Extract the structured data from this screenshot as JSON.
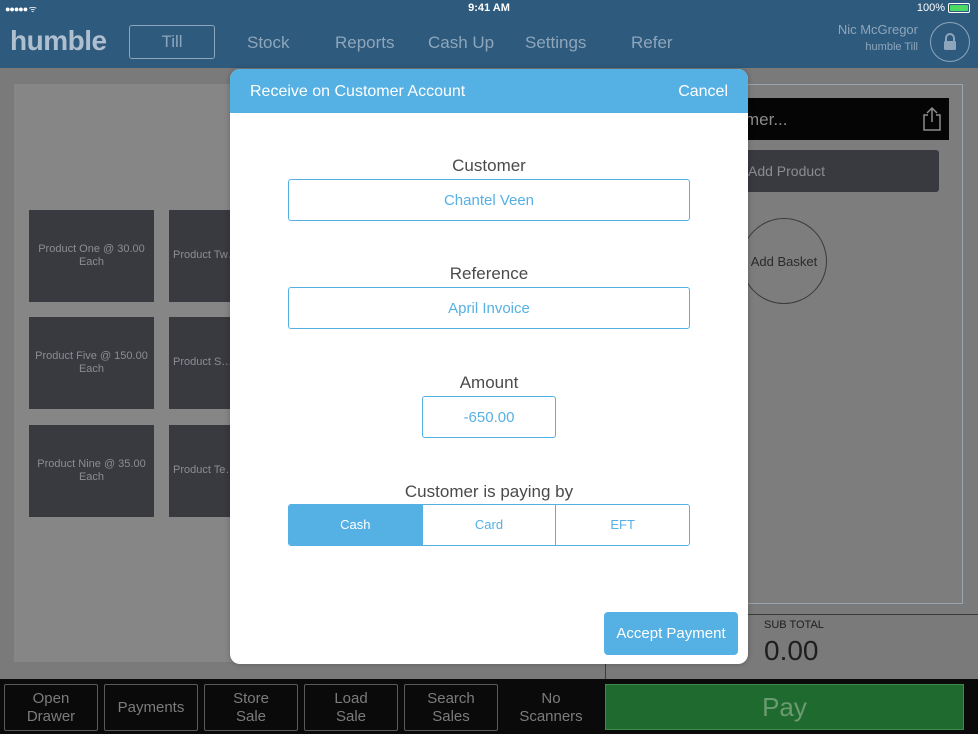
{
  "status_bar": {
    "signal": "●●●●● ᯤ",
    "time": "9:41 AM",
    "battery": "100%",
    "battery_level": 1.0
  },
  "nav": {
    "logo": "humble",
    "items": [
      "Till",
      "Stock",
      "Reports",
      "Cash Up",
      "Settings",
      "Refer"
    ],
    "active": "Till",
    "user_name": "Nic McGregor",
    "user_sub": "humble Till",
    "lock_icon": "lock-icon"
  },
  "products": [
    "Product One @ 30.00 Each",
    "Product Tw… Ea…",
    "Product Five @ 150.00 Each",
    "Product S… Ea…",
    "Product Nine @ 35.00 Each",
    "Product Te… Ea…"
  ],
  "right_panel": {
    "customer_placeholder": "mer...",
    "share_icon": "share-icon",
    "add_product": "Add Product",
    "add_basket": "Add Basket",
    "subtotal_label": "SUB TOTAL",
    "subtotal_value": "0.00"
  },
  "bottom_bar": {
    "buttons": [
      "Open\nDrawer",
      "Payments",
      "Store\nSale",
      "Load\nSale",
      "Search\nSales",
      "No\nScanners"
    ],
    "pay": "Pay"
  },
  "modal": {
    "title": "Receive on Customer Account",
    "cancel": "Cancel",
    "customer_label": "Customer",
    "customer_value": "Chantel Veen",
    "reference_label": "Reference",
    "reference_value": "April Invoice",
    "amount_label": "Amount",
    "amount_value": "-650.00",
    "paying_by_label": "Customer is paying by",
    "payment_options": [
      "Cash",
      "Card",
      "EFT"
    ],
    "selected_option": "Cash",
    "accept": "Accept Payment"
  },
  "colors": {
    "accent": "#55b0e4",
    "nav_bg": "#2e5a7d",
    "pay_green": "#1f6a2e"
  }
}
